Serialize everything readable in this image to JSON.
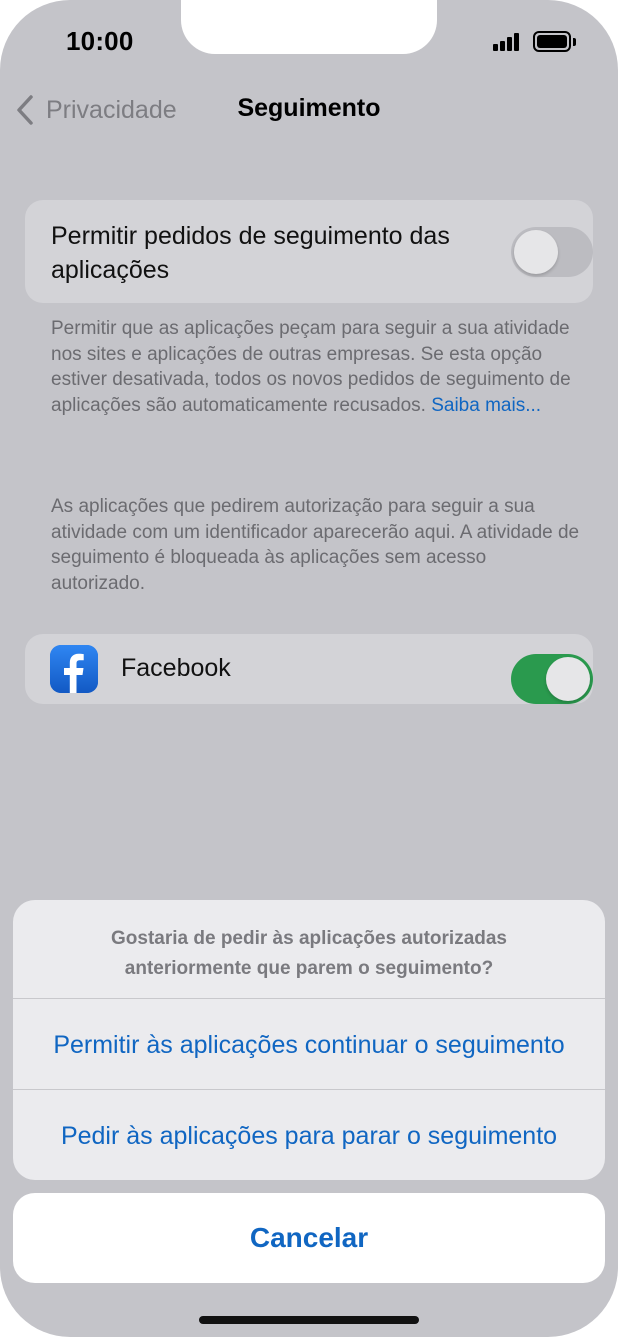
{
  "status_bar": {
    "time": "10:00",
    "signal_icon": "cellular-signal-icon",
    "battery_icon": "battery-full-icon"
  },
  "nav": {
    "back_label": "Privacidade",
    "title": "Seguimento"
  },
  "allow_requests": {
    "label": "Permitir pedidos de seguimento das aplicações",
    "toggle_state": "off",
    "footnote": "Permitir que as aplicações peçam para seguir a sua atividade nos sites e aplicações de outras empresas. Se esta opção estiver desativada, todos os novos pedidos de seguimento de aplicações são automaticamente recusados.",
    "learn_more": "Saiba mais..."
  },
  "apps_note": "As aplicações que pedirem autorização para seguir a sua atividade com um identificador aparecerão aqui. A atividade de seguimento é bloqueada às aplicações sem acesso autorizado.",
  "apps": [
    {
      "name": "Facebook",
      "icon": "facebook-icon",
      "toggle_state": "on"
    }
  ],
  "action_sheet": {
    "message_line1": "Gostaria de pedir às aplicações autorizadas",
    "message_line2": "anteriormente que parem o seguimento?",
    "option_allow": "Permitir às aplicações continuar o seguimento",
    "option_ask_stop": "Pedir às aplicações para parar o seguimento",
    "cancel": "Cancelar"
  },
  "colors": {
    "accent": "#1066c2",
    "toggle_on": "#2a9a4e",
    "dim_background": "#c4c4c9"
  }
}
